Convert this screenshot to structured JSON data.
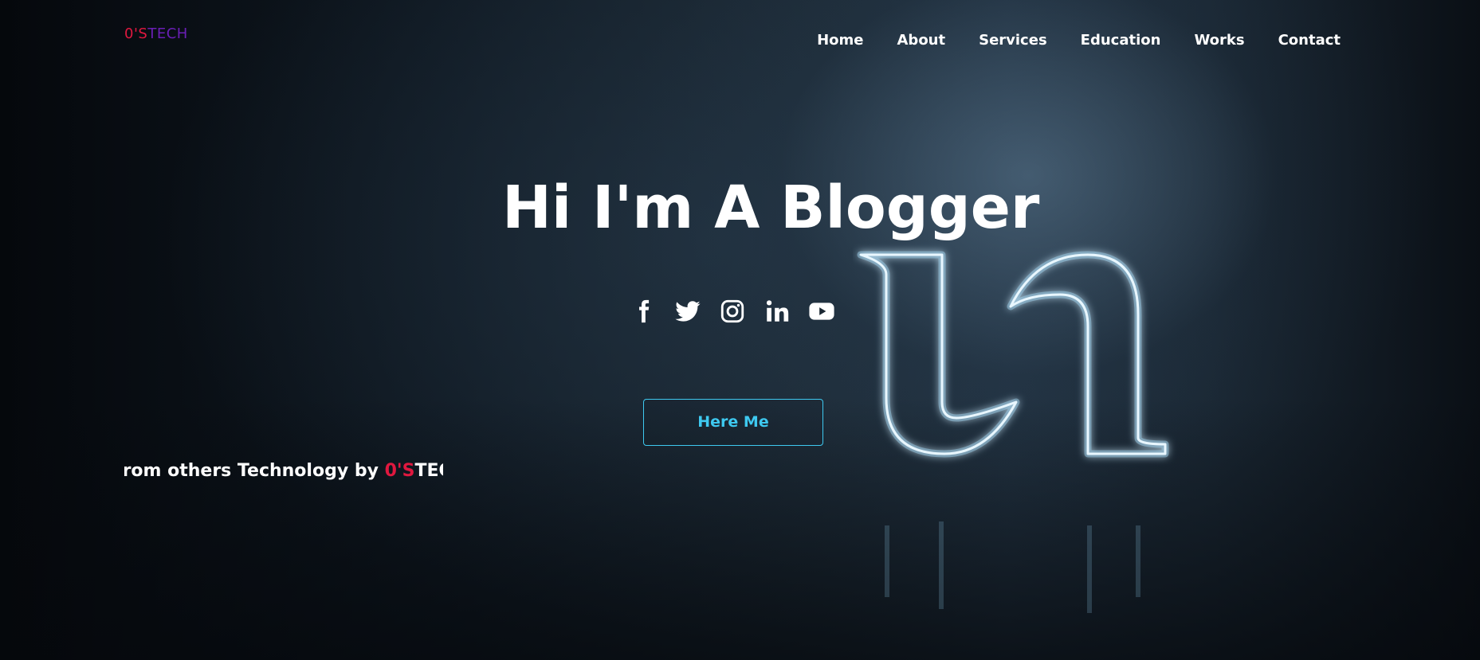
{
  "header": {
    "logo": {
      "part1": "0'S",
      "part2": "TECH"
    },
    "nav": [
      {
        "label": "Home"
      },
      {
        "label": "About"
      },
      {
        "label": "Services"
      },
      {
        "label": "Education"
      },
      {
        "label": "Works"
      },
      {
        "label": "Contact"
      }
    ]
  },
  "hero": {
    "title": "Hi I'm A Blogger",
    "cta_label": "Here Me",
    "socials": [
      "facebook-icon",
      "twitter-icon",
      "instagram-icon",
      "linkedin-icon",
      "youtube-icon"
    ],
    "ticker": {
      "text": "from others Technology by ",
      "brand_part1": "0'S",
      "brand_part2": "TECH"
    }
  },
  "colors": {
    "accent_cyan": "#3ec9f0",
    "brand_red": "#e0183f",
    "brand_purple": "#6a1fb5"
  }
}
